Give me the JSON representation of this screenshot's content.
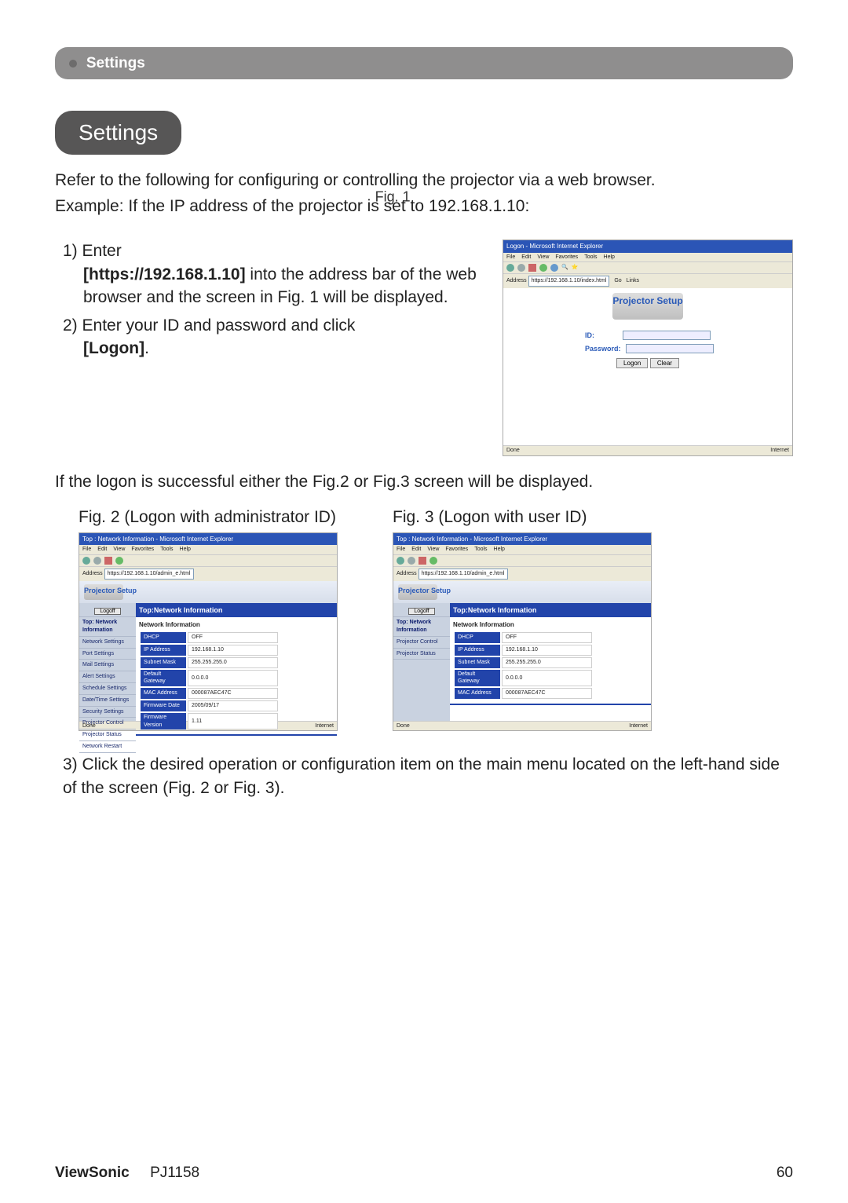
{
  "header": {
    "title": "Settings"
  },
  "pill": "Settings",
  "intro": "Refer to the following for configuring or controlling the projector via a web browser.",
  "example_prefix": "Example: If the IP address of the projector is set to 192.168.1.10:",
  "fig1_over": "Fig. 1",
  "steps": {
    "s1_num": "1)",
    "s1_a": "Enter",
    "s1_url": "[https://192.168.1.10]",
    "s1_b": " into the address bar of the web browser and the screen in Fig. 1 will be displayed.",
    "s2_num": "2)",
    "s2_a": "Enter your ID and password and click ",
    "s2_b": "[Logon]",
    "s2_c": "."
  },
  "mid": "If the logon is successful either the Fig.2 or Fig.3 screen will be displayed.",
  "fig2_caption": "Fig. 2 (Logon with administrator ID)",
  "fig3_caption": "Fig. 3 (Logon with user ID)",
  "step3_num": "3)",
  "step3": "Click the desired operation or configuration item on the main menu located on the left-hand side of the screen (Fig. 2 or Fig. 3).",
  "browser": {
    "title1": "Logon - Microsoft Internet Explorer",
    "title2": "Top : Network Information - Microsoft Internet Explorer",
    "menu": [
      "File",
      "Edit",
      "View",
      "Favorites",
      "Tools",
      "Help"
    ],
    "addr_lbl": "Address",
    "addr1": "https://192.168.1.10/index.html",
    "addr2": "https://192.168.1.10/admin_e.html",
    "go": "Go",
    "links": "Links",
    "status_done": "Done",
    "status_inet": "Internet"
  },
  "fig1": {
    "heading": "Projector Setup",
    "id_label": "ID:",
    "pw_label": "Password:",
    "logon_btn": "Logon",
    "clear_btn": "Clear"
  },
  "panel": {
    "setup": "Projector Setup",
    "main_title": "Top:Network Information",
    "section": "Network Information",
    "logoff": "Logoff",
    "rows": [
      {
        "k": "DHCP",
        "v": "OFF"
      },
      {
        "k": "IP Address",
        "v": "192.168.1.10"
      },
      {
        "k": "Subnet Mask",
        "v": "255.255.255.0"
      },
      {
        "k": "Default Gateway",
        "v": "0.0.0.0"
      },
      {
        "k": "MAC Address",
        "v": "000087AEC47C"
      },
      {
        "k": "Firmware Date",
        "v": "2005/09/17"
      },
      {
        "k": "Firmware Version",
        "v": "1.11"
      }
    ],
    "rows_user": [
      {
        "k": "DHCP",
        "v": "OFF"
      },
      {
        "k": "IP Address",
        "v": "192.168.1.10"
      },
      {
        "k": "Subnet Mask",
        "v": "255.255.255.0"
      },
      {
        "k": "Default Gateway",
        "v": "0.0.0.0"
      },
      {
        "k": "MAC Address",
        "v": "000087AEC47C"
      }
    ],
    "side_admin": [
      "Top: Network Information",
      "Network Settings",
      "Port Settings",
      "Mail Settings",
      "Alert Settings",
      "Schedule Settings",
      "Date/Time Settings",
      "Security Settings",
      "Projector Control",
      "Projector Status",
      "Network Restart"
    ],
    "side_user": [
      "Top: Network Information",
      "Projector Control",
      "Projector Status"
    ]
  },
  "footer": {
    "brand": "ViewSonic",
    "model": "PJ1158",
    "page": "60"
  }
}
